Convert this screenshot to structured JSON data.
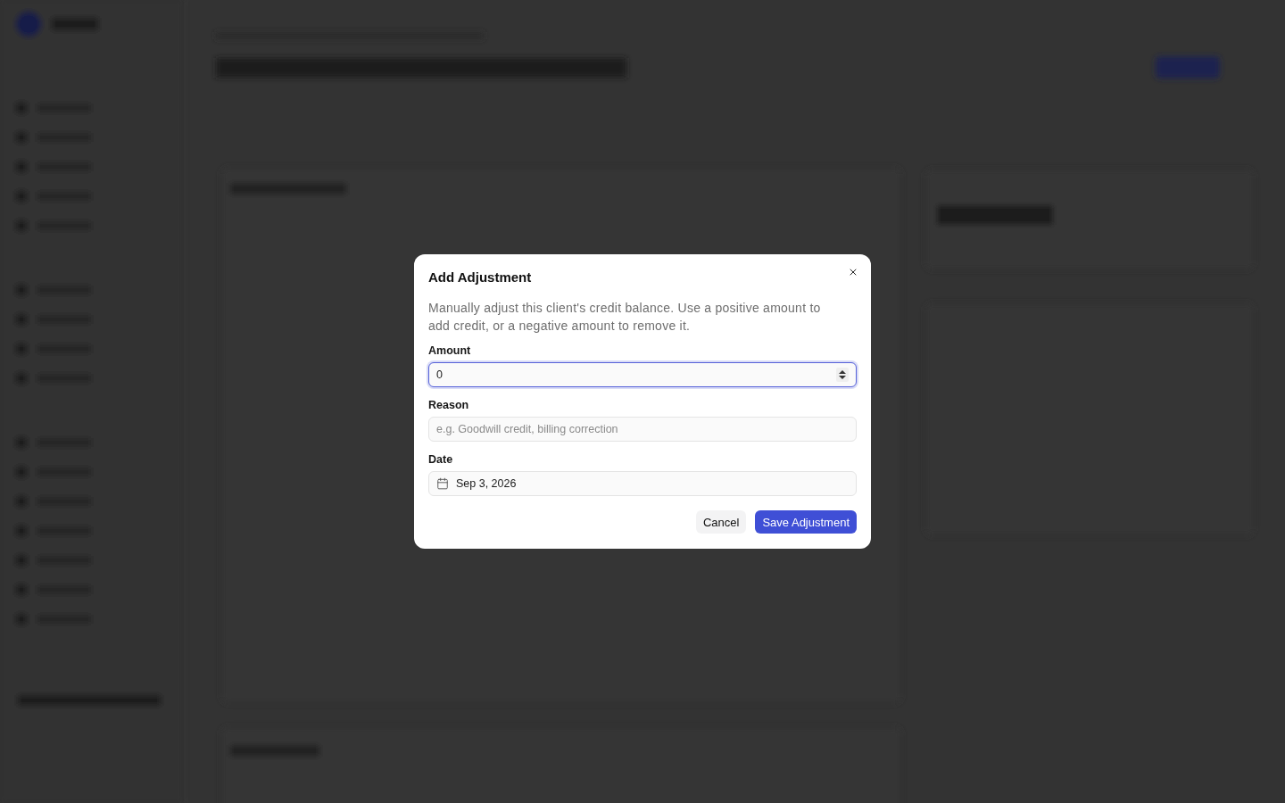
{
  "dialog": {
    "title": "Add Adjustment",
    "description": "Manually adjust this client's credit balance. Use a positive amount to add credit, or a negative amount to remove it.",
    "fields": [
      {
        "kind": "number",
        "label": "Amount",
        "value": "0",
        "focused": true
      },
      {
        "kind": "text",
        "label": "Reason",
        "placeholder": "e.g. Goodwill credit, billing correction",
        "focused": false
      },
      {
        "kind": "date",
        "label": "Date",
        "value": "Sep 3, 2026",
        "focused": false
      }
    ],
    "buttons": [
      {
        "label": "Cancel",
        "kind": "secondary"
      },
      {
        "label": "Save Adjustment",
        "kind": "primary"
      }
    ]
  }
}
